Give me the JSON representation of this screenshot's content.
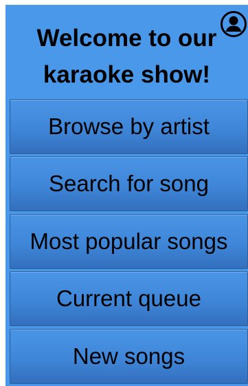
{
  "header": {
    "title": "Welcome to our karaoke show!",
    "profile_icon": "account-circle-icon"
  },
  "menu": {
    "items": [
      {
        "label": "Browse by artist"
      },
      {
        "label": "Search for song"
      },
      {
        "label": "Most popular songs"
      },
      {
        "label": "Current queue"
      },
      {
        "label": "New songs"
      }
    ]
  },
  "colors": {
    "background": "#4a98ea",
    "button": "#3f86d8",
    "text": "#000000"
  }
}
